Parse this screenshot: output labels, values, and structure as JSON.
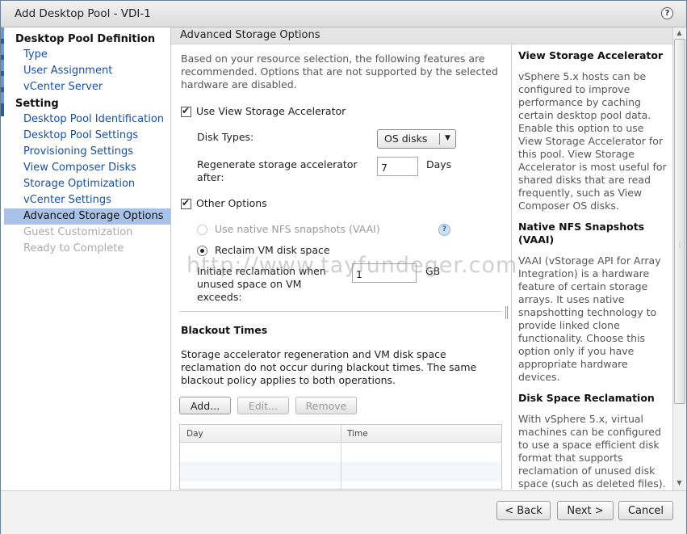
{
  "window": {
    "title": "Add Desktop Pool - VDI-1",
    "help": "?"
  },
  "nav": {
    "sections": [
      {
        "label": "Desktop Pool Definition"
      },
      {
        "label": "Setting"
      }
    ],
    "items": [
      {
        "label": "Type"
      },
      {
        "label": "User Assignment"
      },
      {
        "label": "vCenter Server"
      },
      {
        "label": "Desktop Pool Identification"
      },
      {
        "label": "Desktop Pool Settings"
      },
      {
        "label": "Provisioning Settings"
      },
      {
        "label": "View Composer Disks"
      },
      {
        "label": "Storage Optimization"
      },
      {
        "label": "vCenter Settings"
      },
      {
        "label": "Advanced Storage Options"
      },
      {
        "label": "Guest Customization"
      },
      {
        "label": "Ready to Complete"
      }
    ]
  },
  "main": {
    "header": "Advanced Storage Options",
    "intro": "Based on your resource selection, the following features are recommended. Options that are not supported by the selected hardware are disabled.",
    "view_storage_accelerator": {
      "label": "Use View Storage Accelerator",
      "checked": true,
      "disk_types_label": "Disk Types:",
      "disk_types_value": "OS disks",
      "regen_label": "Regenerate storage accelerator after:",
      "regen_value": "7",
      "regen_unit": "Days"
    },
    "other_options": {
      "label": "Other Options",
      "checked": true,
      "native_nfs": "Use native NFS snapshots (VAAI)",
      "reclaim": "Reclaim VM disk space",
      "reclaim_threshold_label": "Initiate reclamation when unused space on VM exceeds:",
      "reclaim_threshold_value": "1",
      "reclaim_threshold_unit": "GB",
      "help": "?"
    },
    "blackout": {
      "title": "Blackout Times",
      "description": "Storage accelerator regeneration and VM disk space reclamation do not occur during blackout times. The same blackout policy applies to both operations.",
      "add_label": "Add...",
      "edit_label": "Edit...",
      "remove_label": "Remove",
      "columns": [
        "Day",
        "Time"
      ]
    }
  },
  "info": {
    "h1": "View Storage Accelerator",
    "p1": "vSphere 5.x hosts can be configured to improve performance by caching certain desktop pool data. Enable this option to use View Storage Accelerator for this pool. View Storage Accelerator is most useful for shared disks that are read frequently, such as View Composer OS disks.",
    "h2": "Native NFS Snapshots (VAAI)",
    "p2": "VAAI (vStorage API for Array Integration) is a hardware feature of certain storage arrays. It uses native snapshotting technology to provide linked clone functionality. Choose this option only if you have appropriate hardware devices.",
    "h3": "Disk Space Reclamation",
    "p3": "With vSphere 5.x, virtual machines can be configured to use a space efficient disk format that supports reclamation of unused disk space (such as deleted files)."
  },
  "footer": {
    "back_label": "< Back",
    "next_label": "Next >",
    "cancel_label": "Cancel"
  },
  "watermark": "http://www.tayfundeger.com"
}
